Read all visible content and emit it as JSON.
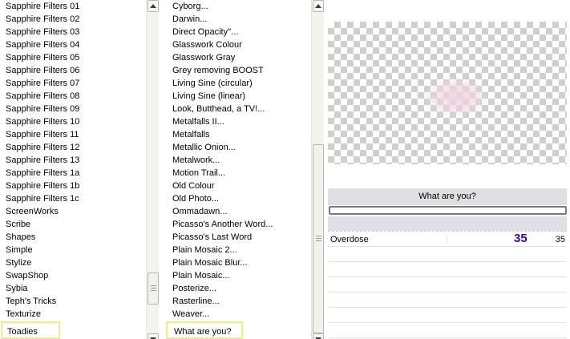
{
  "categories": {
    "items": [
      "Sapphire Filters 01",
      "Sapphire Filters 02",
      "Sapphire Filters 03",
      "Sapphire Filters 04",
      "Sapphire Filters 05",
      "Sapphire Filters 06",
      "Sapphire Filters 07",
      "Sapphire Filters 08",
      "Sapphire Filters 09",
      "Sapphire Filters 10",
      "Sapphire Filters 11",
      "Sapphire Filters 12",
      "Sapphire Filters 13",
      "Sapphire Filters 1a",
      "Sapphire Filters 1b",
      "Sapphire Filters 1c",
      "ScreenWorks",
      "Scribe",
      "Shapes",
      "Simple",
      "Stylize",
      "SwapShop",
      "Sybia",
      "Teph's Tricks",
      "Texturize"
    ],
    "selected": "Toadies"
  },
  "filters": {
    "items": [
      "Cyborg...",
      "Darwin...",
      "Direct Opacity''...",
      "Glasswork Colour",
      "Glasswork Gray",
      "Grey removing BOOST",
      "Living Sine (circular)",
      "Living Sine (linear)",
      "Look, Butthead, a TV!...",
      "Metalfalls II...",
      "Metalfalls",
      "Metallic Onion...",
      "Metalwork...",
      "Motion Trail...",
      "Old Colour",
      "Old Photo...",
      "Ommadawn...",
      "Picasso's Another Word...",
      "Picasso's Last Word",
      "Plain Mosaic 2...",
      "Plain Mosaic Blur...",
      "Plain Mosaic...",
      "Posterize...",
      "Rasterline...",
      "Weaver..."
    ],
    "selected": "What are you?"
  },
  "preview": {
    "filter_title": "What are you?",
    "progress": 0
  },
  "params": [
    {
      "label": "Overdose",
      "value_big": "35",
      "value": "35"
    }
  ],
  "icons": {
    "scroll_up": "arrow-up-icon",
    "scroll_down": "arrow-down-icon"
  },
  "colors": {
    "selection_border": "#e9ee8a",
    "param_value": "#3b0a88",
    "panel_header": "#dfdfe4"
  }
}
